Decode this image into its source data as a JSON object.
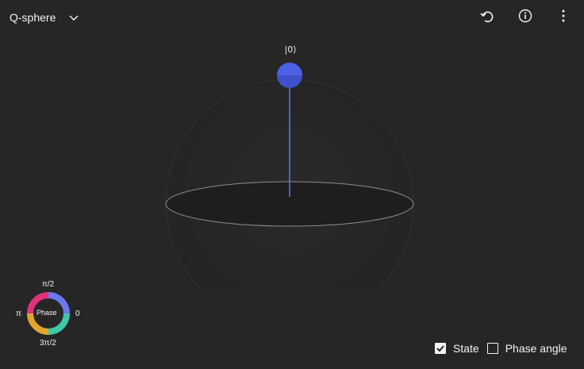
{
  "header": {
    "view_select": {
      "label": "Q-sphere",
      "icon": "chevron-down-icon"
    },
    "tools": [
      {
        "name": "reset-button",
        "icon": "reset-icon"
      },
      {
        "name": "info-button",
        "icon": "info-icon"
      },
      {
        "name": "more-options-button",
        "icon": "overflow-menu-icon"
      }
    ]
  },
  "sphere": {
    "states": [
      {
        "label": "|0⟩",
        "color": "#4a5fe0"
      }
    ]
  },
  "phase_legend": {
    "center_label": "Phase",
    "top": "π/2",
    "left": "π",
    "right": "0",
    "bottom": "3π/2"
  },
  "legend": {
    "state": {
      "label": "State",
      "checked": true
    },
    "phase_angle": {
      "label": "Phase angle",
      "checked": false
    }
  }
}
